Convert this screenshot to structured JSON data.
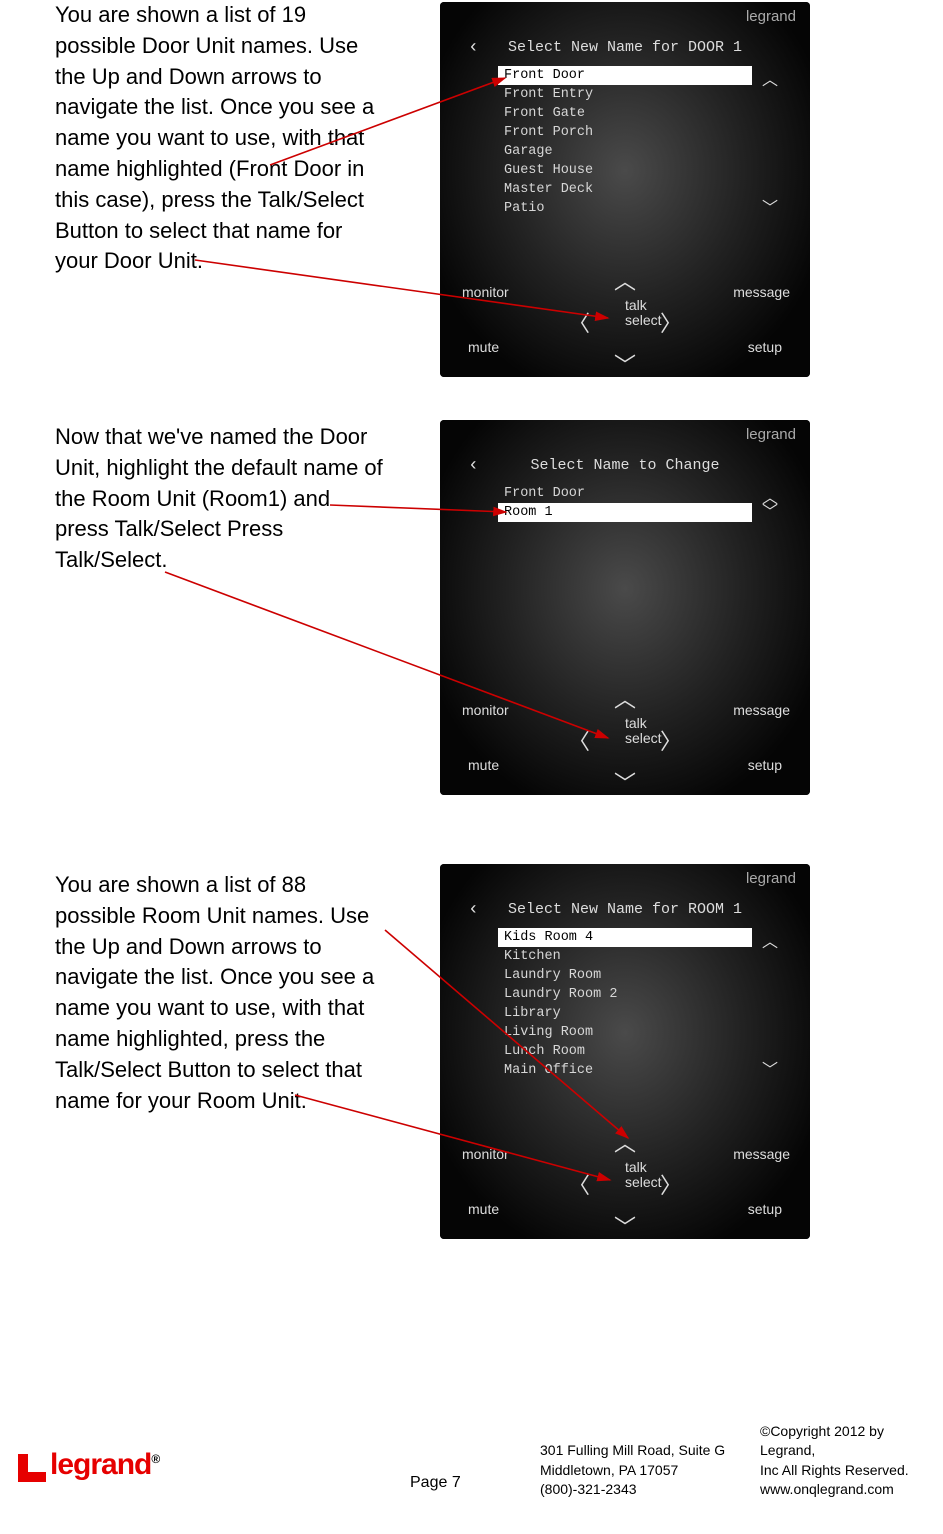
{
  "instructions": {
    "p1": "You are shown a list of 19 possible Door Unit names.  Use the Up and Down arrows to navigate the list. Once you see a name you want to use, with that name highlighted (Front Door in this case), press the Talk/Select Button to select that name for your Door Unit.",
    "p2": "Now that we've named the Door Unit, highlight the default name of the Room Unit (Room1) and press Talk/Select Press Talk/Select.",
    "p3": "You are shown a list of 88 possible Room Unit names. Use the Up and Down arrows to navigate the list. Once you see a name you want to use, with that name highlighted, press the Talk/Select Button to select that name for your Room Unit."
  },
  "device": {
    "brand": "legrand",
    "pad": {
      "monitor": "monitor",
      "message": "message",
      "mute": "mute",
      "setup": "setup",
      "talk": "talk",
      "select": "select"
    }
  },
  "screen1": {
    "title": "Select New Name for DOOR 1",
    "items": [
      "Front Door",
      "Front Entry",
      "Front Gate",
      "Front Porch",
      "Garage",
      "Guest House",
      "Master Deck",
      "Patio"
    ],
    "selected": 0
  },
  "screen2": {
    "title": "Select Name to Change",
    "items": [
      "Front Door",
      "Room 1"
    ],
    "selected": 1
  },
  "screen3": {
    "title": "Select New Name for ROOM 1",
    "items": [
      "Kids Room 4",
      "Kitchen",
      "Laundry Room",
      "Laundry Room 2",
      "Library",
      "Living Room",
      "Lunch Room",
      "Main Office"
    ],
    "selected": 0
  },
  "footer": {
    "logo": "legrand",
    "page": "Page 7",
    "addr_l1": "301 Fulling Mill Road, Suite G",
    "addr_l2": "Middletown, PA   17057",
    "addr_l3": "(800)-321-2343",
    "copy_l1": "©Copyright 2012 by Legrand,",
    "copy_l2": "Inc All Rights Reserved.",
    "copy_l3": "www.onqlegrand.com"
  }
}
